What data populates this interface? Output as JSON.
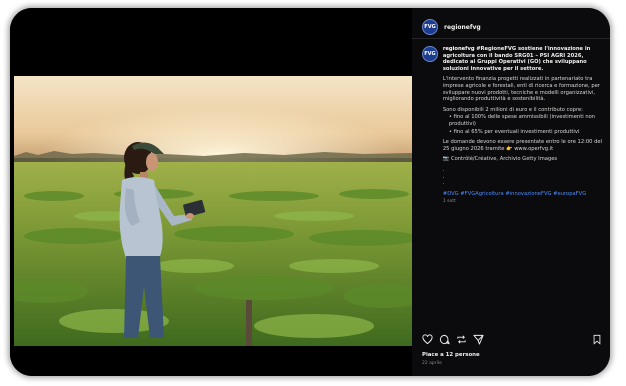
{
  "account": {
    "username": "regionefvg",
    "avatar_text": "FVG"
  },
  "post": {
    "caption_user": "regionefvg",
    "headline": "#RegioneFVG sostiene l'innovazione in agricoltura con il bando SRG01 – PSI AGRI 2026, dedicato ai Gruppi Operativi (GO) che sviluppano soluzioni innovative per il settore.",
    "paragraph1": "L'intervento finanzia progetti realizzati in partenariato tra imprese agricole e forestali, enti di ricerca e formazione, per sviluppare nuovi prodotti, tecniche e modelli organizzativi, migliorando produttività e sostenibilità.",
    "paragraph2_intro": "Sono disponibili 2 milioni di euro e il contributo copre:",
    "bullet1": "fino al 100% delle spese ammissibili (investimenti non produttivi)",
    "bullet2": "fino al 65% per eventuali investimenti produttivi",
    "paragraph3": "Le domande devono essere presentate entro le ore 12:00 del 25 giugno 2026 tramite 👉 www.operfvg.it",
    "credit": "📷 Contrôlé/Créative, Archivio Getty Images",
    "dots": [
      ".",
      ".",
      "."
    ],
    "hashtags": "#DVG #FVGAgricoltura #innovazioneFVG #europaFVG",
    "time_ago": "1 sett"
  },
  "engagement": {
    "likes_text": "Piace a 12 persone",
    "date_text": "22 aprile"
  },
  "icons": {
    "like": "heart-icon",
    "comment": "comment-icon",
    "share": "repost-icon",
    "send": "send-icon",
    "save": "bookmark-icon"
  }
}
